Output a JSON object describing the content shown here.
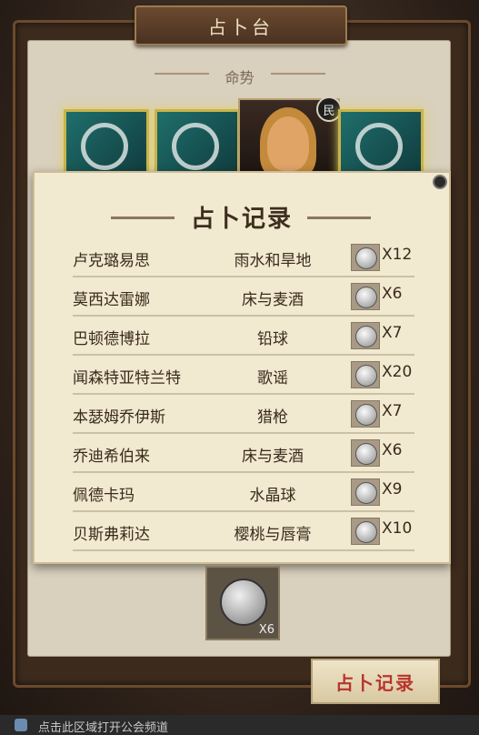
{
  "header": {
    "title": "占卜台"
  },
  "section": {
    "subtitle": "命势"
  },
  "portrait": {
    "badge": "民"
  },
  "record_panel": {
    "title": "占卜记录",
    "rows": [
      {
        "name": "卢克璐易思",
        "item": "雨水和旱地",
        "count": "X12"
      },
      {
        "name": "莫西达雷娜",
        "item": "床与麦酒",
        "count": "X6"
      },
      {
        "name": "巴顿德博拉",
        "item": "铅球",
        "count": "X7"
      },
      {
        "name": "闻森特亚特兰特",
        "item": "歌谣",
        "count": "X20"
      },
      {
        "name": "本瑟姆乔伊斯",
        "item": "猎枪",
        "count": "X7"
      },
      {
        "name": "乔迪希伯来",
        "item": "床与麦酒",
        "count": "X6"
      },
      {
        "name": "佩德卡玛",
        "item": "水晶球",
        "count": "X9"
      },
      {
        "name": "贝斯弗莉达",
        "item": "樱桃与唇膏",
        "count": "X10"
      }
    ]
  },
  "cost": {
    "count": "X6"
  },
  "buttons": {
    "record_label": "占卜记录"
  },
  "guild_bar": {
    "text": "点击此区域打开公会频道"
  }
}
